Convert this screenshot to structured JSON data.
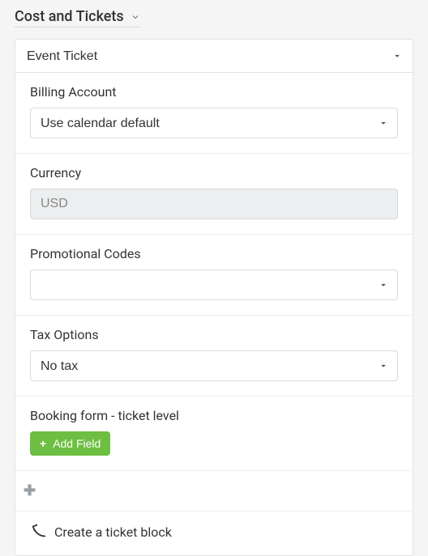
{
  "section": {
    "title": "Cost and Tickets"
  },
  "ticketType": {
    "selected": "Event Ticket"
  },
  "billingAccount": {
    "label": "Billing Account",
    "selected": "Use calendar default"
  },
  "currency": {
    "label": "Currency",
    "value": "USD"
  },
  "promoCodes": {
    "label": "Promotional Codes",
    "selected": ""
  },
  "taxOptions": {
    "label": "Tax Options",
    "selected": "No tax"
  },
  "bookingForm": {
    "label": "Booking form - ticket level",
    "addFieldLabel": "Add Field"
  },
  "createTicketBlock": {
    "label": "Create a ticket block"
  }
}
